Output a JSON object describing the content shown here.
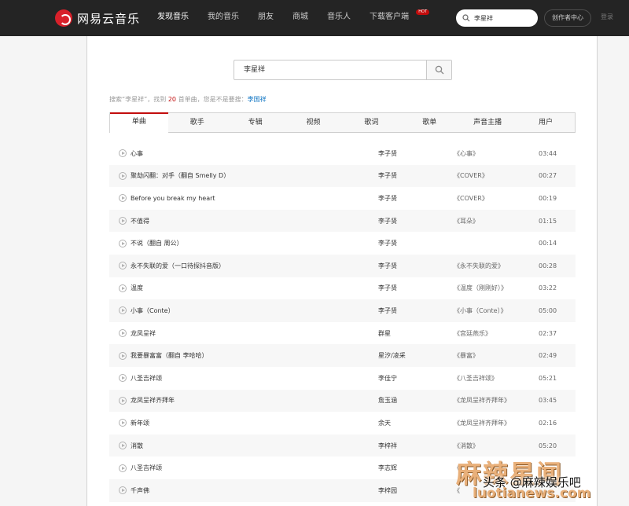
{
  "brand": {
    "name": "网易云音乐"
  },
  "nav": [
    {
      "label": "发现音乐",
      "active": true
    },
    {
      "label": "我的音乐",
      "active": false
    },
    {
      "label": "朋友",
      "active": false
    },
    {
      "label": "商城",
      "active": false
    },
    {
      "label": "音乐人",
      "active": false
    },
    {
      "label": "下载客户端",
      "active": false,
      "badge": "HOT"
    }
  ],
  "top_search": {
    "value": "李星祥",
    "icon": "search-icon"
  },
  "creator_center": "创作者中心",
  "login": "登录",
  "search": {
    "query": "李星祥",
    "icon": "search-icon"
  },
  "summary": {
    "prefix": "搜索“李星祥”，找到 ",
    "count": "20",
    "middle": " 首单曲，您是不是要搜：",
    "suggestion": "李国祥"
  },
  "tabs": [
    {
      "label": "单曲",
      "active": true
    },
    {
      "label": "歌手",
      "active": false
    },
    {
      "label": "专辑",
      "active": false
    },
    {
      "label": "视频",
      "active": false
    },
    {
      "label": "歌词",
      "active": false
    },
    {
      "label": "歌单",
      "active": false
    },
    {
      "label": "声音主播",
      "active": false
    },
    {
      "label": "用户",
      "active": false
    }
  ],
  "songs": [
    {
      "title": "心事",
      "artist": "李子贤",
      "album": "《心事》",
      "duration": "03:44"
    },
    {
      "title": "聚劫闪翻：对手（翻自 Smelly D）",
      "artist": "李子贤",
      "album": "《COVER》",
      "duration": "00:27"
    },
    {
      "title": "Before you break my heart",
      "artist": "李子贤",
      "album": "《COVER》",
      "duration": "00:19"
    },
    {
      "title": "不值得",
      "artist": "李子贤",
      "album": "《耳朵》",
      "duration": "01:15"
    },
    {
      "title": "不说（翻自 周公）",
      "artist": "李子贤",
      "album": "",
      "duration": "00:14"
    },
    {
      "title": "永不失联的爱（一口待探抖音版）",
      "artist": "李子贤",
      "album": "《永不失联的爱》",
      "duration": "00:28"
    },
    {
      "title": "温度",
      "artist": "李子贤",
      "album": "《温度（刚刚好）》",
      "duration": "03:22"
    },
    {
      "title": "小事（Conte）",
      "artist": "李子贤",
      "album": "《小事（Conte）》",
      "duration": "05:00"
    },
    {
      "title": "龙凤呈祥",
      "artist": "群星",
      "album": "《宫廷燕乐》",
      "duration": "02:37"
    },
    {
      "title": "我要暴富富（翻自 李哈哈）",
      "artist": "星汐/凌采",
      "album": "《暴富》",
      "duration": "02:49"
    },
    {
      "title": "八圣吉祥颂",
      "artist": "李佳宁",
      "album": "《八圣吉祥颂》",
      "duration": "05:21"
    },
    {
      "title": "龙凤呈祥齐拜年",
      "artist": "詹玉涵",
      "album": "《龙凤呈祥齐拜年》",
      "duration": "03:45"
    },
    {
      "title": "新年颂",
      "artist": "余天",
      "album": "《龙凤呈祥齐拜年》",
      "duration": "02:16"
    },
    {
      "title": "消散",
      "artist": "李梓祥",
      "album": "《消散》",
      "duration": "05:20"
    },
    {
      "title": "八圣吉祥颂",
      "artist": "李志辉",
      "album": "《",
      "duration": ""
    },
    {
      "title": "千声佛",
      "artist": "李梓园",
      "album": "《",
      "duration": ""
    }
  ],
  "watermark": {
    "big": "麻辣星闻",
    "mid": "头条 @麻辣娱乐吧",
    "url": "luotianews.com"
  },
  "colors": {
    "accent": "#c20c0c",
    "topbar": "#242424",
    "link": "#0c73c2"
  }
}
